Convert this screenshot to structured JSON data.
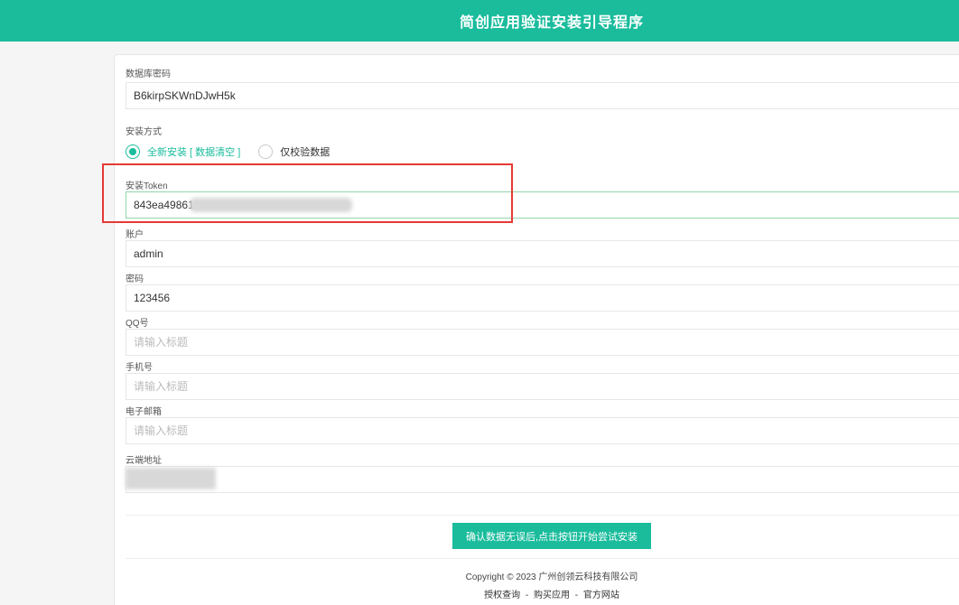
{
  "header": {
    "title": "简创应用验证安装引导程序"
  },
  "form": {
    "db_password": {
      "label": "数据库密码",
      "value": "B6kirpSKWnDJwH5k"
    },
    "install_mode": {
      "label": "安装方式",
      "options": [
        {
          "label": "全新安装 [ 数据清空 ]",
          "selected": true
        },
        {
          "label": "仅校验数据",
          "selected": false
        }
      ]
    },
    "token": {
      "label": "安装Token",
      "value": "843ea49861"
    },
    "account": {
      "label": "账户",
      "value": "admin"
    },
    "password": {
      "label": "密码",
      "value": "123456"
    },
    "qq": {
      "label": "QQ号",
      "placeholder": "请输入标题"
    },
    "phone": {
      "label": "手机号",
      "placeholder": "请输入标题"
    },
    "email": {
      "label": "电子邮箱",
      "placeholder": "请输入标题"
    },
    "cloud": {
      "label": "云端地址"
    },
    "submit_label": "确认数据无误后,点击按钮开始尝试安装"
  },
  "footer": {
    "copyright": "Copyright © 2023 广州创领云科技有限公司",
    "links": [
      "授权查询",
      "购买应用",
      "官方网站"
    ],
    "separator": "-"
  },
  "colors": {
    "accent": "#1abc9c",
    "highlight": "#e53935"
  }
}
